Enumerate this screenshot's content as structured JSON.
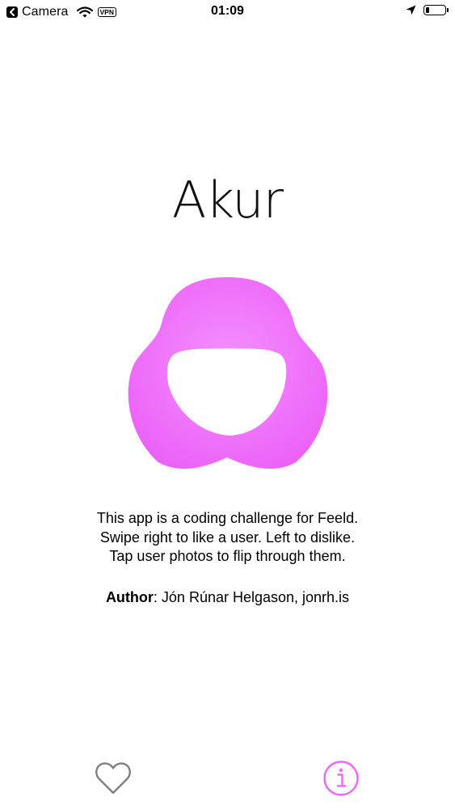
{
  "status_bar": {
    "back_label": "Camera",
    "vpn_label": "VPN",
    "time": "01:09",
    "battery_level": 0.2
  },
  "main": {
    "title": "Akur",
    "description_lines": [
      "This app is a coding challenge for Feeld.",
      "Swipe right to like a user. Left to dislike.",
      "Tap user photos to flip through them."
    ],
    "author_label": "Author",
    "author_value": ": Jón Rúnar Helgason, jonrh.is"
  },
  "tab_bar": {
    "tabs": [
      {
        "icon": "heart-outline-icon",
        "selected": false
      },
      {
        "icon": "info-circle-icon",
        "selected": true
      }
    ]
  },
  "colors": {
    "accent": "#ee66fa",
    "icon_inactive": "#808080"
  }
}
